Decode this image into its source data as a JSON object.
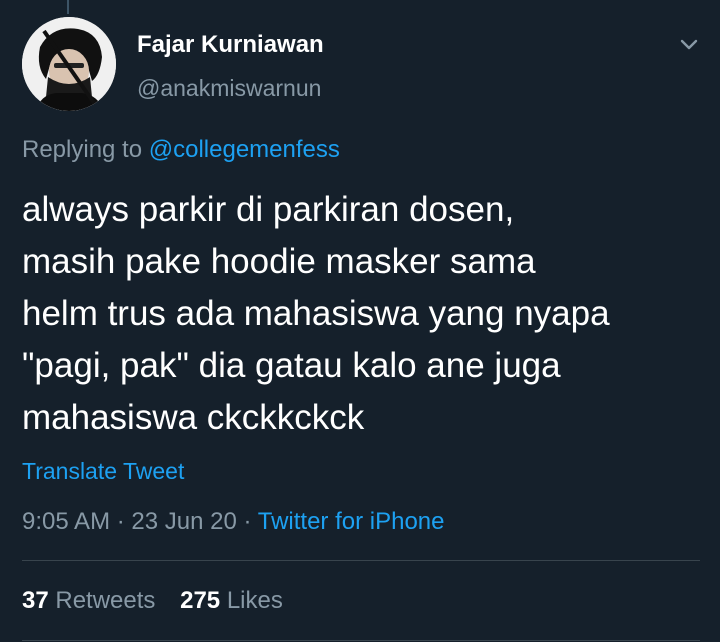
{
  "colors": {
    "background": "#15202b",
    "text_primary": "#ffffff",
    "text_secondary": "#8899a6",
    "link": "#1da1f2",
    "divider": "#38444d"
  },
  "tweet": {
    "display_name": "Fajar Kurniawan",
    "handle": "@anakmiswarnun",
    "avatar_icon": "profile-photo-icon",
    "menu_icon": "chevron-down-icon",
    "replying_prefix": "Replying to",
    "replying_to": "@collegemenfess",
    "text_lines": [
      "always parkir di parkiran dosen,",
      "masih pake hoodie masker sama",
      "helm trus ada mahasiswa yang nyapa",
      "\"pagi, pak\" dia gatau kalo ane juga",
      "mahasiswa ckckkckck"
    ],
    "translate_label": "Translate Tweet",
    "time": "9:05 AM",
    "separator": "·",
    "date": "23 Jun 20",
    "source": "Twitter for iPhone"
  },
  "stats": {
    "retweets_count": "37",
    "retweets_label": "Retweets",
    "likes_count": "275",
    "likes_label": "Likes"
  }
}
